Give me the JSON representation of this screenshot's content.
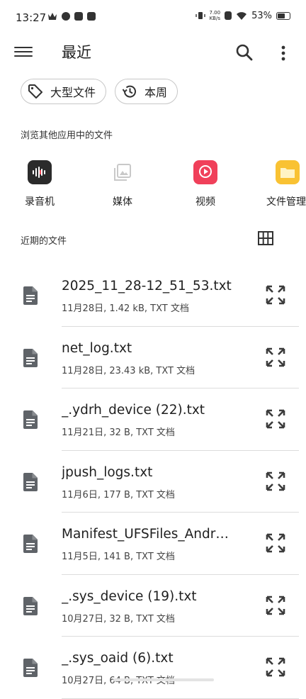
{
  "status_bar": {
    "time": "13:27",
    "net_speed_value": "7.00",
    "net_speed_unit": "KB/s",
    "battery_percent": "53%",
    "battery_level": 0.53
  },
  "app_bar": {
    "title": "最近",
    "search_icon": "search-icon",
    "more_icon": "more-vert-icon",
    "menu_icon": "menu-icon"
  },
  "chips": [
    {
      "label": "大型文件",
      "icon": "tag-icon"
    },
    {
      "label": "本周",
      "icon": "history-icon"
    }
  ],
  "browse_section": {
    "label": "浏览其他应用中的文件",
    "apps": [
      {
        "label": "录音机",
        "icon": "recorder-icon",
        "color": "#2b2b2b"
      },
      {
        "label": "媒体",
        "icon": "media-icon",
        "color": "#e8e8e8"
      },
      {
        "label": "视频",
        "icon": "video-icon",
        "color": "#f0405a"
      },
      {
        "label": "文件管理",
        "icon": "folder-icon",
        "color": "#f9c233"
      }
    ]
  },
  "recent_section": {
    "label": "近期的文件",
    "view_toggle_icon": "grid-view-icon"
  },
  "files": [
    {
      "name": "2025_11_28-12_51_53.txt",
      "meta": "11月28日, 1.42 kB, TXT 文档"
    },
    {
      "name": "net_log.txt",
      "meta": "11月28日, 23.43 kB, TXT 文档"
    },
    {
      "name": "_.ydrh_device (22).txt",
      "meta": "11月21日, 32 B, TXT 文档"
    },
    {
      "name": "jpush_logs.txt",
      "meta": "11月6日, 177 B, TXT 文档"
    },
    {
      "name": "Manifest_UFSFiles_Andr…",
      "meta": "11月5日, 141 B, TXT 文档"
    },
    {
      "name": "_.sys_device (19).txt",
      "meta": "10月27日, 32 B, TXT 文档"
    },
    {
      "name": "_.sys_oaid (6).txt",
      "meta": "10月27日, 64 B, TXT 文档"
    }
  ]
}
